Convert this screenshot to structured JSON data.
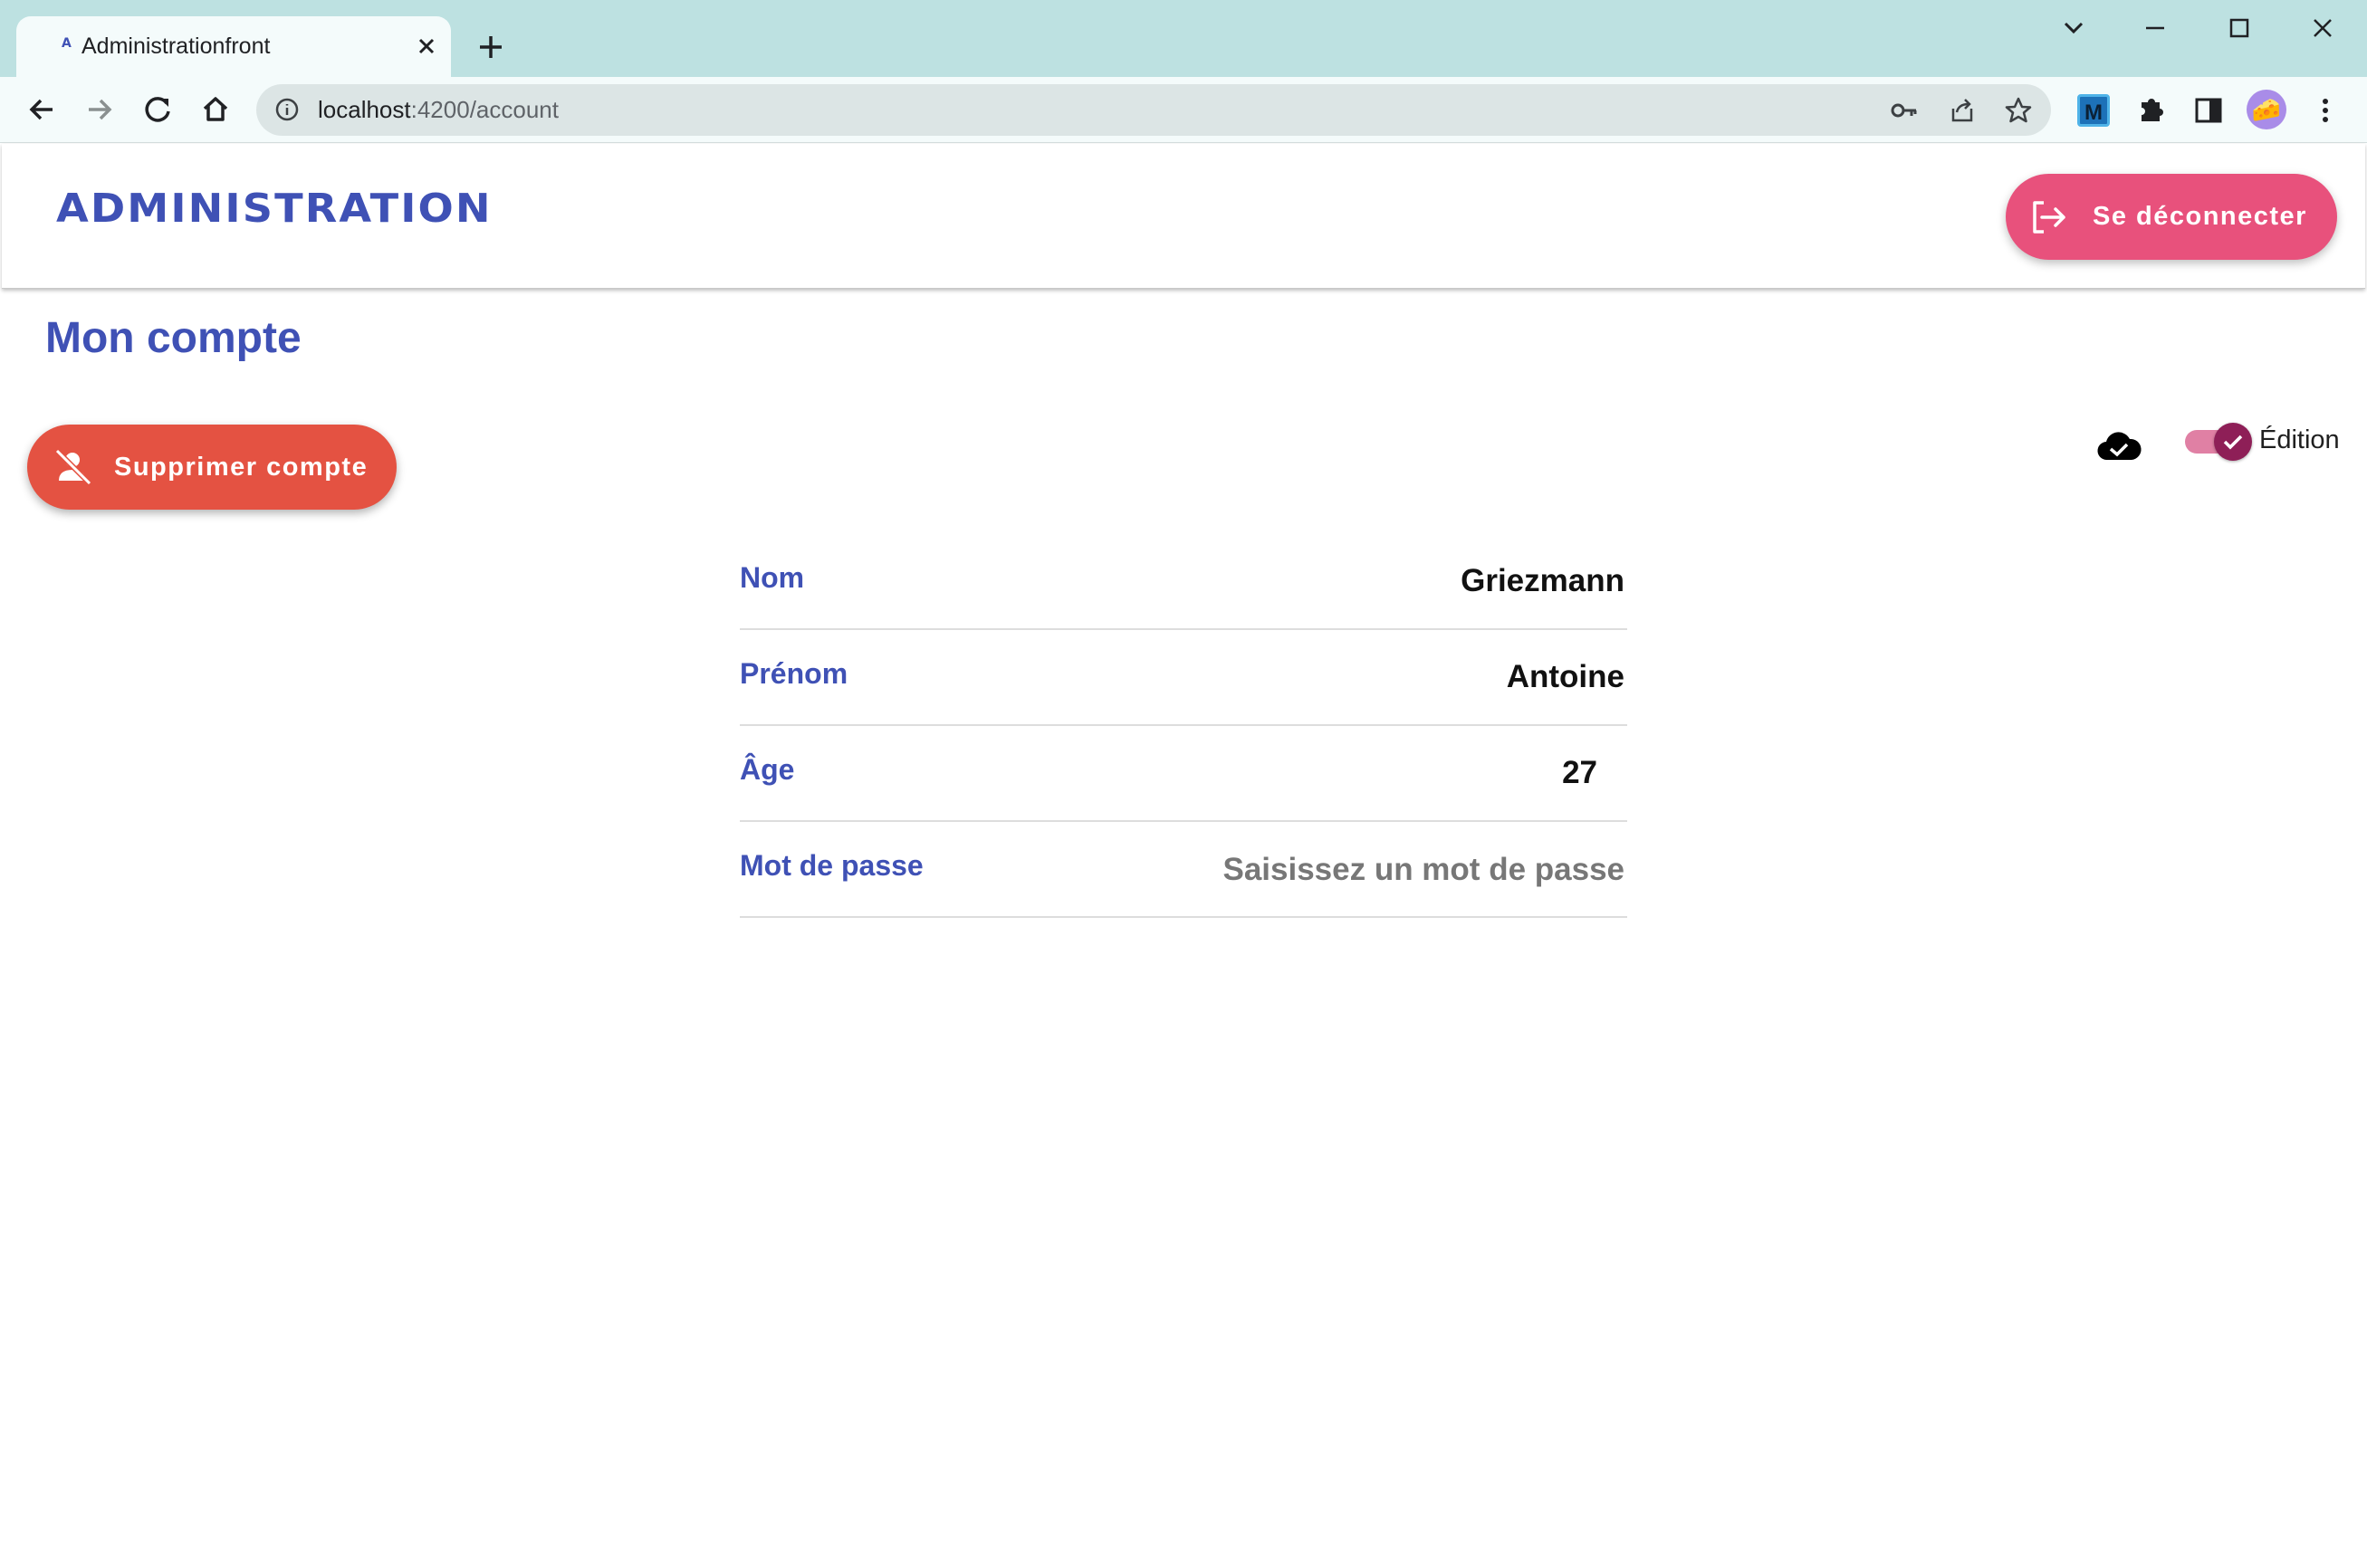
{
  "browser": {
    "tab_title": "Administrationfront",
    "favicon": "A",
    "url_host": "localhost",
    "url_rest": ":4200/account",
    "profile_emoji": "🧀",
    "extension_m": "M"
  },
  "header": {
    "brand": "ADMINISTRATION",
    "logout_label": "Se déconnecter"
  },
  "page": {
    "title": "Mon compte",
    "delete_label": "Supprimer compte",
    "edit_toggle_label": "Édition",
    "edit_toggle_on": true
  },
  "form": {
    "nom": {
      "label": "Nom",
      "value": "Griezmann"
    },
    "prenom": {
      "label": "Prénom",
      "value": "Antoine"
    },
    "age": {
      "label": "Âge",
      "value": "27"
    },
    "password": {
      "label": "Mot de passe",
      "value": "",
      "placeholder": "Saisissez un mot de passe"
    }
  },
  "colors": {
    "primary": "#3f51b5",
    "logout_button": "#e8517c",
    "delete_button": "#e45242",
    "toggle_thumb": "#8e1f57",
    "toggle_track": "#e080a4",
    "tabstrip": "#bde1e1"
  },
  "icons": {
    "logout": "logout-icon",
    "delete": "person-off-icon",
    "saved": "cloud-done-icon"
  }
}
